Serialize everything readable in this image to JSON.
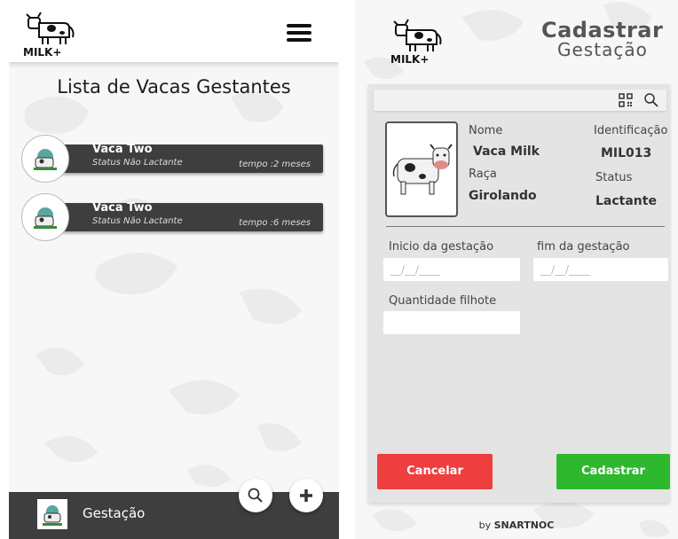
{
  "list_screen": {
    "title": "Lista de Vacas Gestantes",
    "cows": [
      {
        "name": "Vaca Two",
        "status": "Status Não Lactante",
        "time": "tempo :2 meses"
      },
      {
        "name": "Vaca Two",
        "status": "Status Não Lactante",
        "time": "tempo :6 meses"
      }
    ],
    "bottom_nav_label": "Gestação"
  },
  "register_screen": {
    "title_line1": "Cadastrar",
    "title_line2": "Gestação",
    "cow": {
      "nome_label": "Nome",
      "nome_value": "Vaca Milk",
      "raca_label": "Raça",
      "raca_value": "Girolando",
      "id_label": "Identificação",
      "id_value": "MIL013",
      "status_label": "Status",
      "status_value": "Lactante"
    },
    "inicio_label": "Inicio da gestação",
    "inicio_placeholder": "__/__/____",
    "fim_label": "fim da gestação",
    "fim_placeholder": "__/__/____",
    "quantidade_label": "Quantidade filhote",
    "cancel_label": "Cancelar",
    "submit_label": "Cadastrar",
    "byline_prefix": "by ",
    "byline_brand": "SNARTNOC"
  },
  "logo_text": "MILK+",
  "colors": {
    "dark": "#3e3e3e",
    "cancel": "#ef3e3e",
    "submit": "#2eb82e",
    "text": "#555555"
  },
  "icons": [
    "menu-icon",
    "search-icon",
    "plus-icon",
    "qr-code-icon",
    "cow-avatar-icon",
    "cow-illustration"
  ]
}
